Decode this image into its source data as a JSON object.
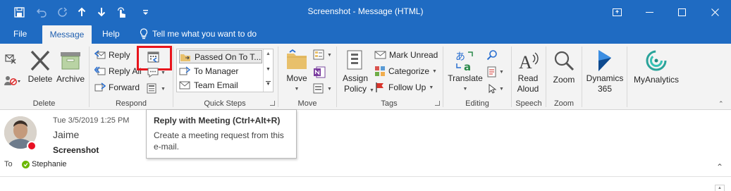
{
  "window": {
    "title": "Screenshot  -  Message (HTML)"
  },
  "tabs": [
    {
      "label": "File"
    },
    {
      "label": "Message"
    },
    {
      "label": "Help"
    }
  ],
  "tell_me": "Tell me what you want to do",
  "ribbon": {
    "delete": {
      "group": "Delete",
      "delete_label": "Delete",
      "archive_label": "Archive"
    },
    "respond": {
      "group": "Respond",
      "reply": "Reply",
      "reply_all": "Reply All",
      "forward": "Forward"
    },
    "quick_steps": {
      "group": "Quick Steps",
      "items": [
        "Passed On To T...",
        "To Manager",
        "Team Email"
      ]
    },
    "move": {
      "group": "Move",
      "move_label": "Move"
    },
    "tags": {
      "group": "Tags",
      "assign_policy": "Assign Policy",
      "mark_unread": "Mark Unread",
      "categorize": "Categorize",
      "follow_up": "Follow Up"
    },
    "editing": {
      "group": "Editing",
      "translate": "Translate"
    },
    "speech": {
      "group": "Speech",
      "read_aloud": "Read Aloud"
    },
    "zoom": {
      "group": "Zoom",
      "zoom_label": "Zoom"
    },
    "dynamics": {
      "label": "Dynamics 365"
    },
    "myanalytics": {
      "label": "MyAnalytics"
    }
  },
  "tooltip": {
    "title": "Reply with Meeting (Ctrl+Alt+R)",
    "body": "Create a meeting request from this e-mail."
  },
  "message": {
    "date": "Tue 3/5/2019 1:25 PM",
    "sender": "Jaime",
    "subject": "Screenshot",
    "to_label": "To",
    "recipient": "Stephanie"
  },
  "colors": {
    "titlebar": "#1f6bc2",
    "ribbon_bg": "#f3f3f3",
    "highlight_box": "#e8141c",
    "presence_busy": "#e81123",
    "presence_available": "#6bb700"
  }
}
